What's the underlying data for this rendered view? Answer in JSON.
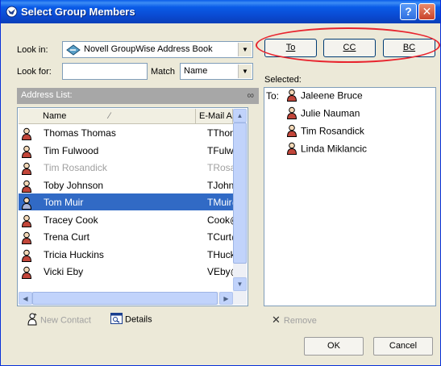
{
  "window": {
    "title": "Select Group Members"
  },
  "look_in": {
    "label": "Look in:",
    "value": "Novell GroupWise Address Book"
  },
  "look_for": {
    "label": "Look for:",
    "value": ""
  },
  "match": {
    "label": "Match",
    "value": "Name"
  },
  "buttons": {
    "to": "To",
    "cc": "CC",
    "bc": "BC",
    "ok": "OK",
    "cancel": "Cancel"
  },
  "address_list": {
    "header": "Address List:",
    "columns": [
      "Name",
      "E-Mail A"
    ],
    "rows": [
      {
        "name": "Thomas Thomas",
        "email": "TThom"
      },
      {
        "name": "Tim Fulwood",
        "email": "TFulwo"
      },
      {
        "name": "Tim Rosandick",
        "email": "TRosa"
      },
      {
        "name": "Toby Johnson",
        "email": "TJohns"
      },
      {
        "name": "Tom Muir",
        "email": "TMuir@"
      },
      {
        "name": "Tracey Cook",
        "email": "Cook@"
      },
      {
        "name": "Trena Curt",
        "email": "TCurt@"
      },
      {
        "name": "Tricia Huckins",
        "email": "THuck"
      },
      {
        "name": "Vicki Eby",
        "email": "VEby@"
      }
    ],
    "selected_row": "Tom Muir"
  },
  "selected": {
    "label": "Selected:",
    "prefix": "To:",
    "members": [
      "Jaleene Bruce",
      "Julie Nauman",
      "Tim Rosandick",
      "Linda Miklancic"
    ]
  },
  "footer": {
    "new_contact": "New Contact",
    "details": "Details",
    "remove": "Remove"
  },
  "colors": {
    "selection": "#316ac5",
    "highlight_oval": "#e8242e",
    "titlebar": "#0a5ce8"
  }
}
